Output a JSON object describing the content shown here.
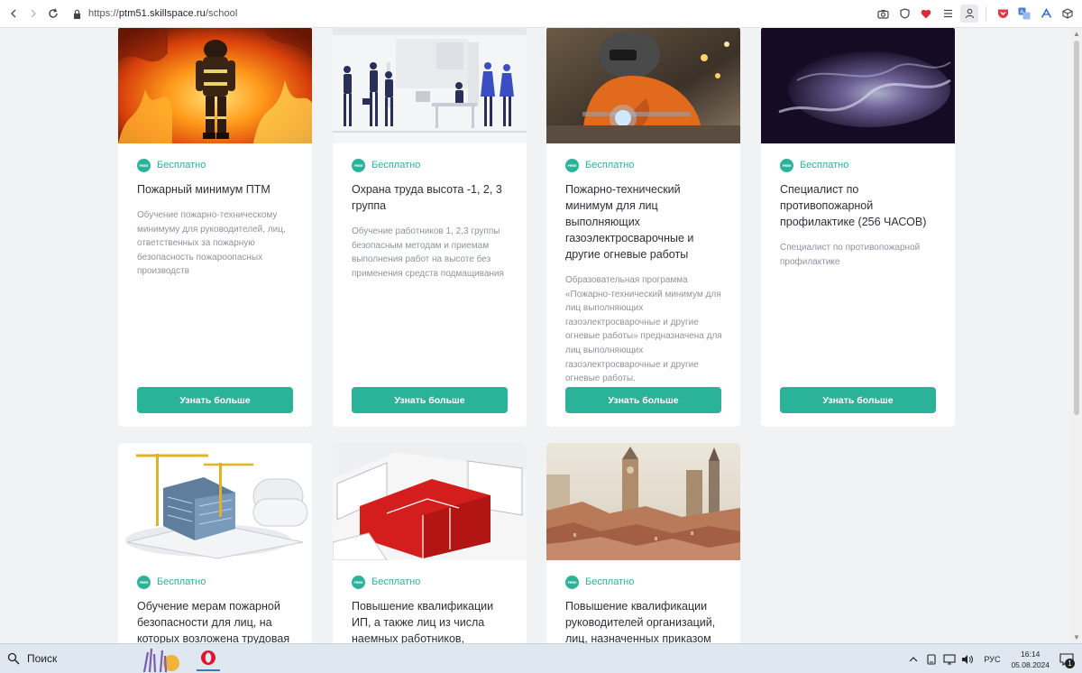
{
  "browser": {
    "url_prefix": "https://",
    "url_host": "ptm51.skillspace.ru",
    "url_path": "/school"
  },
  "badge_label": "Бесплатно",
  "free_icon_text": "FREE",
  "cards": [
    {
      "title": "Пожарный минимум ПТМ",
      "description": "Обучение пожарно-техническому минимуму для руководителей, лиц, ответственных за пожарную безопасность пожароопасных производств",
      "button": "Узнать больше",
      "image": "firefighter-in-fire"
    },
    {
      "title": "Охрана труда высота -1, 2, 3 группа",
      "description": "Обучение работников 1, 2,3 группы безопасным методам и приемам выполнения работ на высоте без применения средств подмащивания",
      "button": "Узнать больше",
      "image": "office-people-illustration"
    },
    {
      "title": "Пожарно-технический минимум для лиц выполняющих газоэлектросварочные и другие огневые работы",
      "description": "Образовательная программа «Пожарно-технический минимум для лиц выполняющих газоэлектросварочные и другие огневые работы» предназначена для лиц выполняющих газоэлектросварочные и другие огневые работы.",
      "button": "Узнать больше",
      "image": "welder"
    },
    {
      "title": "Специалист по противопожарной профилактике (256 ЧАСОВ)",
      "description": "Специалист по противопожарной профилактике",
      "button": "Узнать больше",
      "image": "smoke"
    },
    {
      "title": "Обучение мерам пожарной безопасности для лиц, на которых возложена трудовая",
      "image": "construction-blueprints"
    },
    {
      "title": "Повышение квалификации ИП, а также лиц из числа наемных работников,",
      "image": "red-3d-floorplan"
    },
    {
      "title": "Повышение квалификации руководителей организаций, лиц, назначенных приказом",
      "image": "old-city"
    }
  ],
  "taskbar": {
    "search_label": "Поиск",
    "language": "РУС",
    "time": "16:14",
    "date": "05.08.2024",
    "notifications": "1"
  },
  "colors": {
    "accent": "#2bb39a",
    "background": "#f1f2f4"
  }
}
